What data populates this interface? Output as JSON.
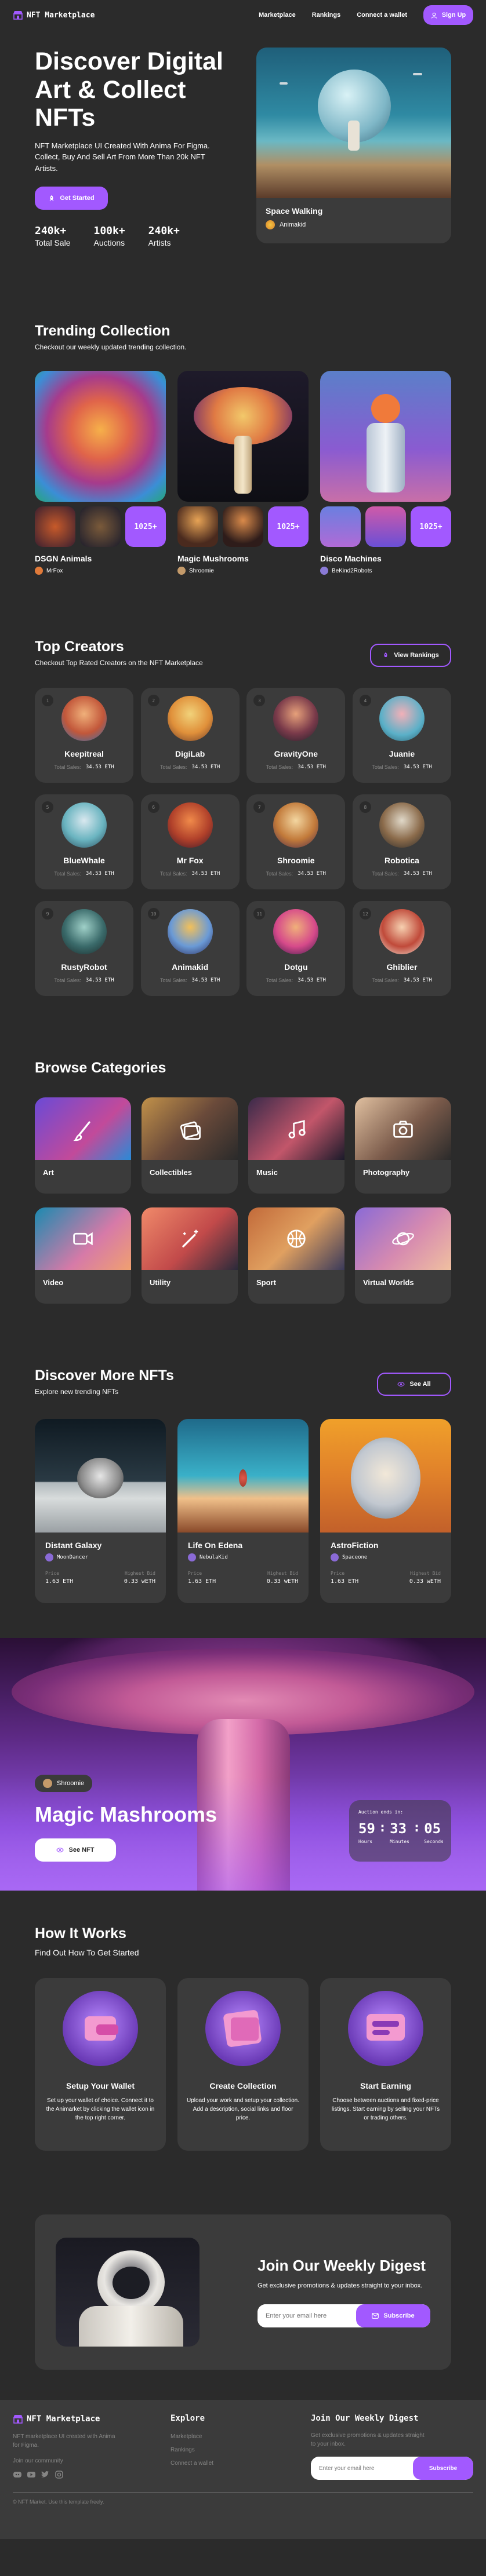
{
  "nav": {
    "brand": "NFT Marketplace",
    "links": [
      "Marketplace",
      "Rankings",
      "Connect a wallet"
    ],
    "signup": "Sign Up"
  },
  "hero": {
    "title": "Discover Digital Art & Collect NFTs",
    "desc": "NFT Marketplace UI Created With Anima For Figma. Collect, Buy And Sell Art From More Than 20k NFT Artists.",
    "cta": "Get Started",
    "stats": [
      {
        "value": "240k+",
        "label": "Total Sale"
      },
      {
        "value": "100k+",
        "label": "Auctions"
      },
      {
        "value": "240k+",
        "label": "Artists"
      }
    ],
    "card": {
      "title": "Space Walking",
      "artist": "Animakid"
    }
  },
  "trending": {
    "title": "Trending Collection",
    "subtitle": "Checkout our weekly updated trending collection.",
    "collections": [
      {
        "name": "DSGN Animals",
        "artist": "MrFox",
        "count": "1025+"
      },
      {
        "name": "Magic Mushrooms",
        "artist": "Shroomie",
        "count": "1025+"
      },
      {
        "name": "Disco Machines",
        "artist": "BeKind2Robots",
        "count": "1025+"
      }
    ]
  },
  "creators": {
    "title": "Top Creators",
    "subtitle": "Checkout Top Rated Creators on the NFT Marketplace",
    "button": "View Rankings",
    "sales_label": "Total Sales:",
    "items": [
      {
        "rank": "1",
        "name": "Keepitreal",
        "sales": "34.53 ETH"
      },
      {
        "rank": "2",
        "name": "DigiLab",
        "sales": "34.53 ETH"
      },
      {
        "rank": "3",
        "name": "GravityOne",
        "sales": "34.53 ETH"
      },
      {
        "rank": "4",
        "name": "Juanie",
        "sales": "34.53 ETH"
      },
      {
        "rank": "5",
        "name": "BlueWhale",
        "sales": "34.53 ETH"
      },
      {
        "rank": "6",
        "name": "Mr Fox",
        "sales": "34.53 ETH"
      },
      {
        "rank": "7",
        "name": "Shroomie",
        "sales": "34.53 ETH"
      },
      {
        "rank": "8",
        "name": "Robotica",
        "sales": "34.53 ETH"
      },
      {
        "rank": "9",
        "name": "RustyRobot",
        "sales": "34.53 ETH"
      },
      {
        "rank": "10",
        "name": "Animakid",
        "sales": "34.53 ETH"
      },
      {
        "rank": "11",
        "name": "Dotgu",
        "sales": "34.53 ETH"
      },
      {
        "rank": "12",
        "name": "Ghiblier",
        "sales": "34.53 ETH"
      }
    ]
  },
  "categories": {
    "title": "Browse Categories",
    "items": [
      "Art",
      "Collectibles",
      "Music",
      "Photography",
      "Video",
      "Utility",
      "Sport",
      "Virtual Worlds"
    ]
  },
  "discover": {
    "title": "Discover More NFTs",
    "subtitle": "Explore new trending NFTs",
    "button": "See All",
    "price_label": "Price",
    "bid_label": "Highest Bid",
    "items": [
      {
        "name": "Distant Galaxy",
        "artist": "MoonDancer",
        "price": "1.63 ETH",
        "bid": "0.33 wETH"
      },
      {
        "name": "Life On Edena",
        "artist": "NebulaKid",
        "price": "1.63 ETH",
        "bid": "0.33 wETH"
      },
      {
        "name": "AstroFiction",
        "artist": "Spaceone",
        "price": "1.63 ETH",
        "bid": "0.33 wETH"
      }
    ]
  },
  "feature": {
    "artist": "Shroomie",
    "title": "Magic Mashrooms",
    "button": "See NFT",
    "timer_label": "Auction ends in:",
    "timer": [
      {
        "value": "59",
        "label": "Hours"
      },
      {
        "value": "33",
        "label": "Minutes"
      },
      {
        "value": "05",
        "label": "Seconds"
      }
    ]
  },
  "how": {
    "title": "How It Works",
    "subtitle": "Find Out How To Get Started",
    "steps": [
      {
        "title": "Setup Your Wallet",
        "desc": "Set up your wallet of choice. Connect it to the Animarket by clicking the wallet icon in the top right corner."
      },
      {
        "title": "Create Collection",
        "desc": "Upload your work and setup your collection. Add a description, social links and floor price."
      },
      {
        "title": "Start Earning",
        "desc": "Choose between auctions and fixed-price listings. Start earning by selling your NFTs or trading others."
      }
    ]
  },
  "digest": {
    "title": "Join Our Weekly Digest",
    "desc": "Get exclusive promotions & updates straight to your inbox.",
    "placeholder": "Enter your email here",
    "button": "Subscribe"
  },
  "footer": {
    "brand": "NFT Marketplace",
    "desc": "NFT marketplace UI created with Anima for Figma.",
    "community": "Join our community",
    "explore_title": "Explore",
    "explore": [
      "Marketplace",
      "Rankings",
      "Connect a wallet"
    ],
    "digest_title": "Join Our Weekly Digest",
    "digest_desc": "Get exclusive promotions & updates straight to your inbox.",
    "placeholder": "Enter your email here",
    "button": "Subscribe",
    "copyright": "© NFT Market. Use this template freely."
  },
  "colors": {
    "bg": "#2B2B2B",
    "card": "#3B3B3B",
    "accent": "#A259FF",
    "muted": "#858584"
  }
}
